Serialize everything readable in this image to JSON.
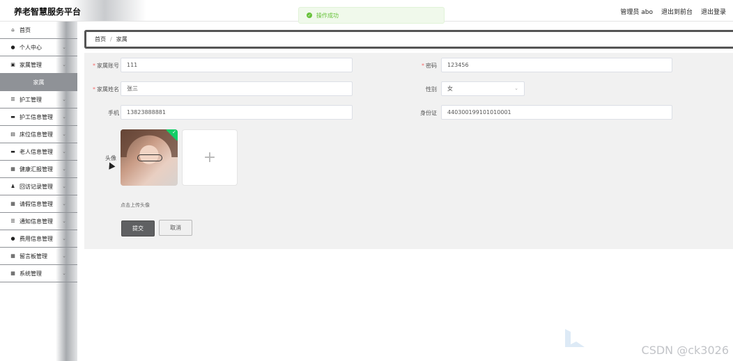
{
  "app": {
    "title": "养老智慧服务平台"
  },
  "header": {
    "links": [
      "管理员 abo",
      "退出到前台",
      "退出登录"
    ]
  },
  "toast": {
    "text": "操作成功",
    "icon": "check-circle-icon"
  },
  "sidebar": {
    "items": [
      {
        "label": "首页",
        "icon": "home-icon",
        "has_chevron": false
      },
      {
        "label": "个人中心",
        "icon": "user-icon",
        "has_chevron": true
      },
      {
        "label": "家属管理",
        "icon": "clipboard-icon",
        "has_chevron": true
      }
    ],
    "active_sub": "家属",
    "items2": [
      {
        "label": "护工管理",
        "icon": "list-icon"
      },
      {
        "label": "护工信息管理",
        "icon": "monitor-icon"
      },
      {
        "label": "床位信息管理",
        "icon": "bed-icon"
      },
      {
        "label": "老人信息管理",
        "icon": "id-card-icon"
      },
      {
        "label": "健康汇报管理",
        "icon": "grid-icon"
      },
      {
        "label": "回访记录管理",
        "icon": "person-icon"
      },
      {
        "label": "请假信息管理",
        "icon": "grid-icon"
      },
      {
        "label": "通知信息管理",
        "icon": "list-icon"
      },
      {
        "label": "费用信息管理",
        "icon": "user-group-icon"
      },
      {
        "label": "留言板管理",
        "icon": "grid-icon"
      },
      {
        "label": "系统管理",
        "icon": "grid-icon"
      }
    ]
  },
  "breadcrumb": {
    "home": "首页",
    "current": "家属"
  },
  "form": {
    "account_label": "家属账号",
    "account_value": "111",
    "password_label": "密码",
    "password_value": "123456",
    "name_label": "家属姓名",
    "name_value": "张三",
    "gender_label": "性别",
    "gender_value": "女",
    "phone_label": "手机",
    "phone_value": "13823888881",
    "idcard_label": "身份证",
    "idcard_value": "440300199101010001",
    "avatar_label": "头像",
    "upload_plus": "+",
    "upload_hint": "点击上传头像",
    "submit_label": "提交",
    "cancel_label": "取消"
  },
  "watermark": "CSDN @ck3026"
}
